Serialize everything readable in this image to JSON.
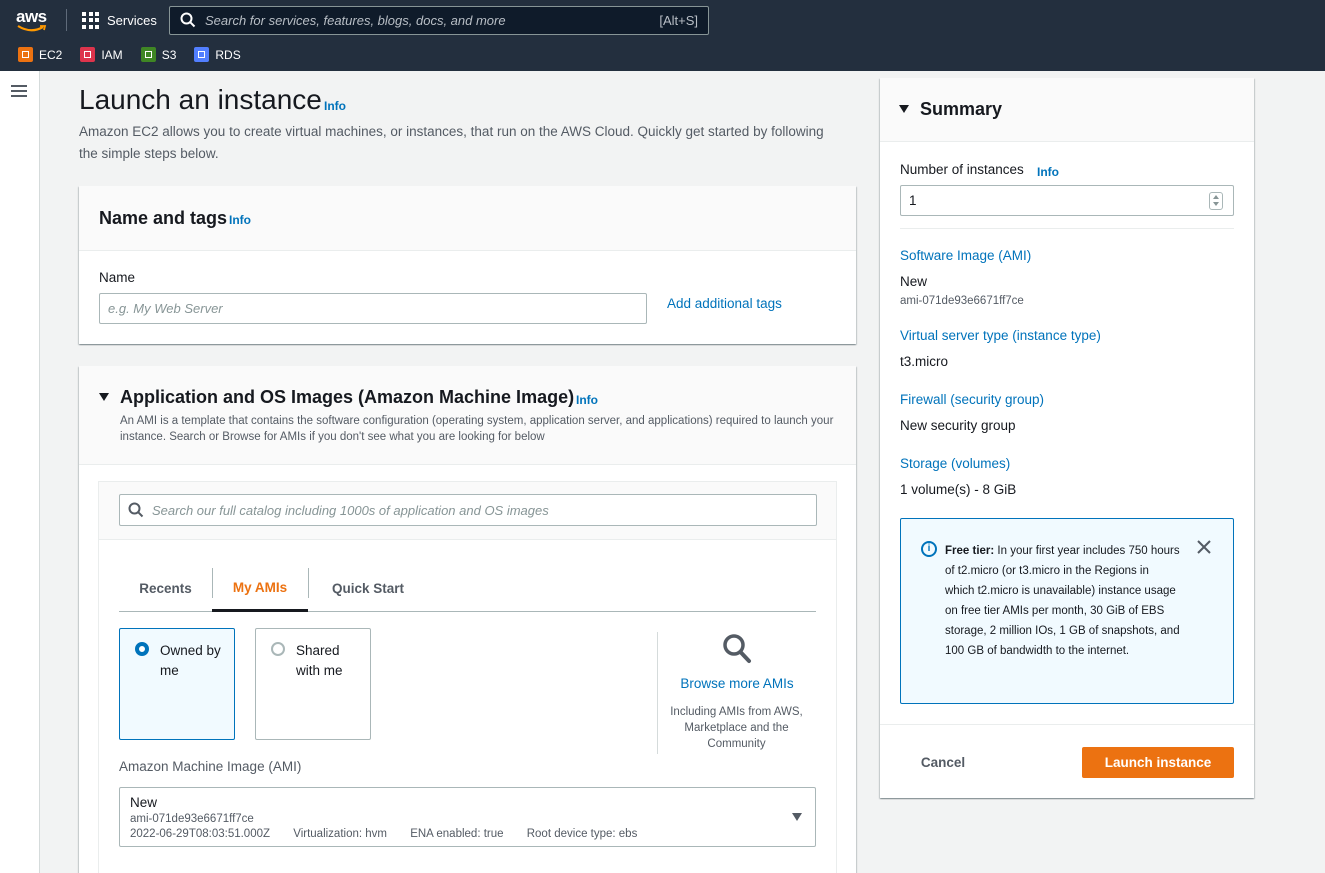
{
  "topnav": {
    "logo_text": "aws",
    "services_label": "Services",
    "search_placeholder": "Search for services, features, blogs, docs, and more",
    "search_shortcut": "[Alt+S]",
    "favorites": [
      {
        "label": "EC2",
        "color": "#ec7211"
      },
      {
        "label": "IAM",
        "color": "#dd344c"
      },
      {
        "label": "S3",
        "color": "#3f8624"
      },
      {
        "label": "RDS",
        "color": "#527fff"
      }
    ]
  },
  "page": {
    "title": "Launch an instance",
    "info": "Info",
    "description": "Amazon EC2 allows you to create virtual machines, or instances, that run on the AWS Cloud. Quickly get started by following the simple steps below."
  },
  "name_tags": {
    "title": "Name and tags",
    "info": "Info",
    "name_label": "Name",
    "name_placeholder": "e.g. My Web Server",
    "add_tags": "Add additional tags"
  },
  "ami": {
    "title": "Application and OS Images (Amazon Machine Image)",
    "info": "Info",
    "description": "An AMI is a template that contains the software configuration (operating system, application server, and applications) required to launch your instance. Search or Browse for AMIs if you don't see what you are looking for below",
    "search_placeholder": "Search our full catalog including 1000s of application and OS images",
    "tabs": [
      "Recents",
      "My AMIs",
      "Quick Start"
    ],
    "active_tab": "My AMIs",
    "owned_label": "Owned by me",
    "shared_label": "Shared with me",
    "browse_link": "Browse more AMIs",
    "browse_note": "Including AMIs from AWS, Marketplace and the Community",
    "field_label": "Amazon Machine Image (AMI)",
    "selected": {
      "name": "New",
      "id": "ami-071de93e6671ff7ce",
      "date": "2022-06-29T08:03:51.000Z",
      "virtualization": "Virtualization: hvm",
      "ena": "ENA enabled: true",
      "root": "Root device type: ebs"
    }
  },
  "summary": {
    "title": "Summary",
    "num_instances_label": "Number of instances",
    "info": "Info",
    "num_instances_value": "1",
    "software_image_link": "Software Image (AMI)",
    "software_image_value": "New",
    "software_image_id": "ami-071de93e6671ff7ce",
    "instance_type_link": "Virtual server type (instance type)",
    "instance_type_value": "t3.micro",
    "firewall_link": "Firewall (security group)",
    "firewall_value": "New security group",
    "storage_link": "Storage (volumes)",
    "storage_value": "1 volume(s) - 8 GiB",
    "free_tier_bold": "Free tier:",
    "free_tier_text": " In your first year includes 750 hours of t2.micro (or t3.micro in the Regions in which t2.micro is unavailable) instance usage on free tier AMIs per month, 30 GiB of EBS storage, 2 million IOs, 1 GB of snapshots, and 100 GB of bandwidth to the internet.",
    "cancel": "Cancel",
    "launch": "Launch instance"
  }
}
